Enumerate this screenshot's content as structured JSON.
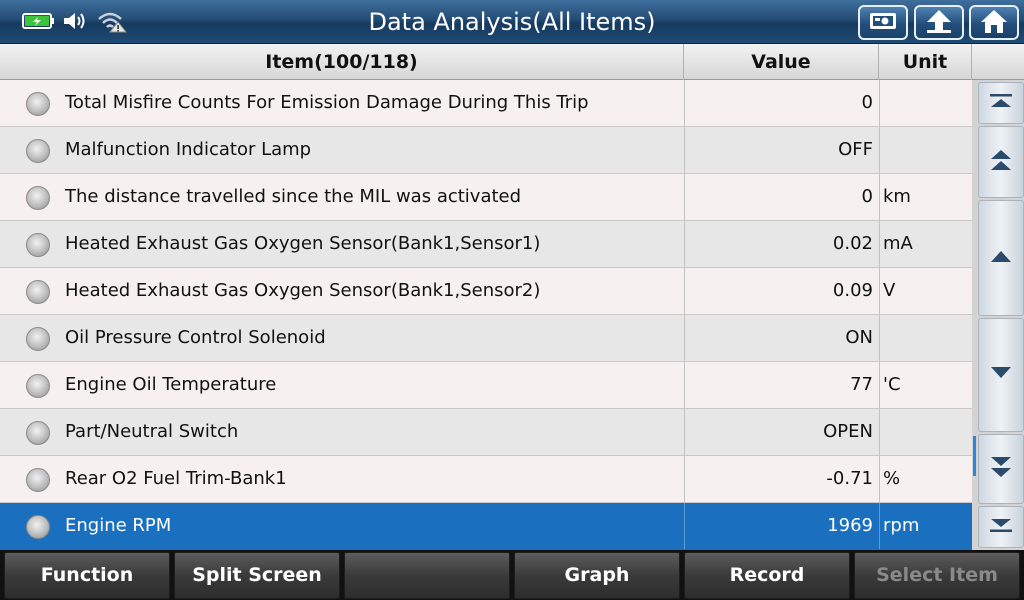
{
  "header": {
    "title": "Data Analysis(All Items)",
    "status_icons": [
      "battery-charging-icon",
      "volume-icon",
      "wifi-warning-icon"
    ],
    "buttons": [
      "screenshot-icon",
      "back-arrow-icon",
      "home-icon"
    ]
  },
  "table": {
    "columns": {
      "item": "Item(100/118)",
      "value": "Value",
      "unit": "Unit"
    },
    "rows": [
      {
        "name": "Total Misfire Counts For Emission Damage During This Trip",
        "value": "0",
        "unit": ""
      },
      {
        "name": "Malfunction Indicator Lamp",
        "value": "OFF",
        "unit": ""
      },
      {
        "name": "The distance travelled since the MIL was activated",
        "value": "0",
        "unit": "km"
      },
      {
        "name": "Heated Exhaust Gas Oxygen Sensor(Bank1,Sensor1)",
        "value": "0.02",
        "unit": "mA"
      },
      {
        "name": "Heated Exhaust Gas Oxygen Sensor(Bank1,Sensor2)",
        "value": "0.09",
        "unit": "V"
      },
      {
        "name": "Oil Pressure Control Solenoid",
        "value": "ON",
        "unit": ""
      },
      {
        "name": "Engine Oil Temperature",
        "value": "77",
        "unit": "'C"
      },
      {
        "name": "Part/Neutral Switch",
        "value": "OPEN",
        "unit": ""
      },
      {
        "name": "Rear O2 Fuel Trim-Bank1",
        "value": "-0.71",
        "unit": "%"
      },
      {
        "name": "Engine RPM",
        "value": "1969",
        "unit": "rpm"
      }
    ],
    "selected_row": "Engine RPM"
  },
  "toolbar": {
    "function": "Function",
    "split_screen": "Split Screen",
    "empty": "",
    "graph": "Graph",
    "record": "Record",
    "select_item": "Select Item"
  },
  "colors": {
    "title_bar": "#234c75",
    "selected_row": "#1a6fbe",
    "battery": "#3cc43c"
  }
}
